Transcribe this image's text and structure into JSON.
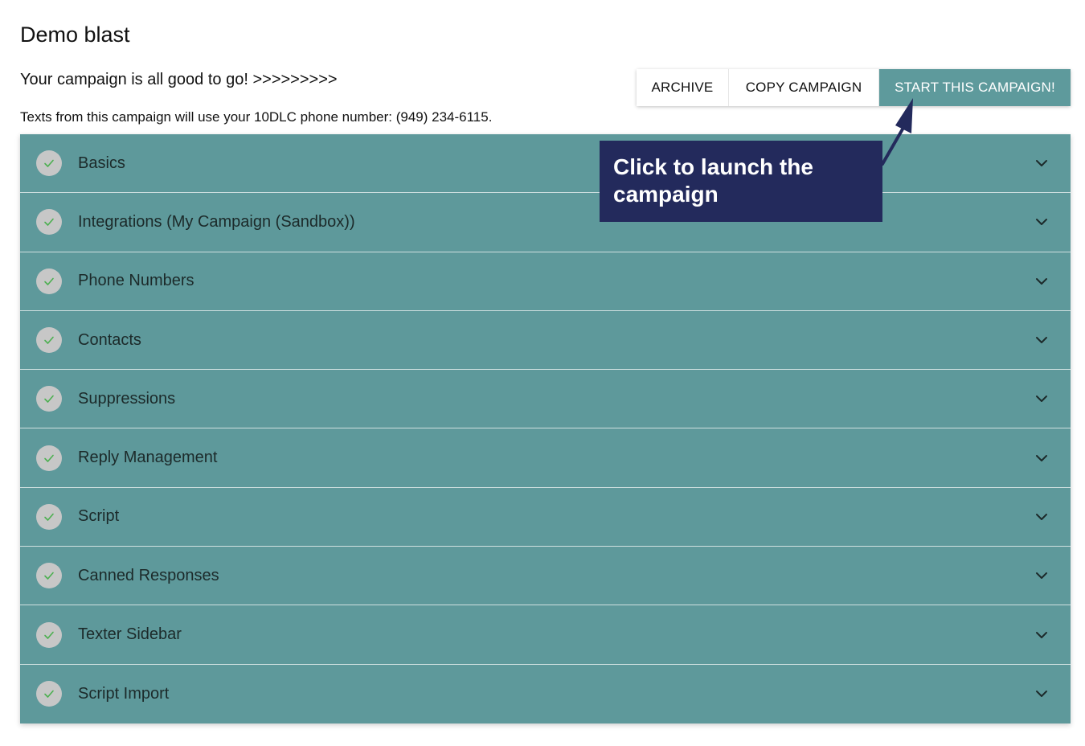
{
  "header": {
    "title": "Demo blast",
    "status": "Your campaign is all good to go! >>>>>>>>>",
    "phone_note": "Texts from this campaign will use your 10DLC phone number: (949) 234-6115."
  },
  "actions": {
    "archive": "ARCHIVE",
    "copy": "COPY CAMPAIGN",
    "start": "START THIS CAMPAIGN!"
  },
  "sections": [
    {
      "label": "Basics"
    },
    {
      "label": "Integrations (My Campaign (Sandbox))"
    },
    {
      "label": "Phone Numbers"
    },
    {
      "label": "Contacts"
    },
    {
      "label": "Suppressions"
    },
    {
      "label": "Reply Management"
    },
    {
      "label": "Script"
    },
    {
      "label": "Canned Responses"
    },
    {
      "label": "Texter Sidebar"
    },
    {
      "label": "Script Import"
    }
  ],
  "callout": {
    "text": "Click to launch the campaign"
  },
  "colors": {
    "accent": "#5e999b",
    "callout_bg": "#232a5c",
    "check_bg": "#c7c7c7",
    "check_mark": "#4caf50"
  }
}
